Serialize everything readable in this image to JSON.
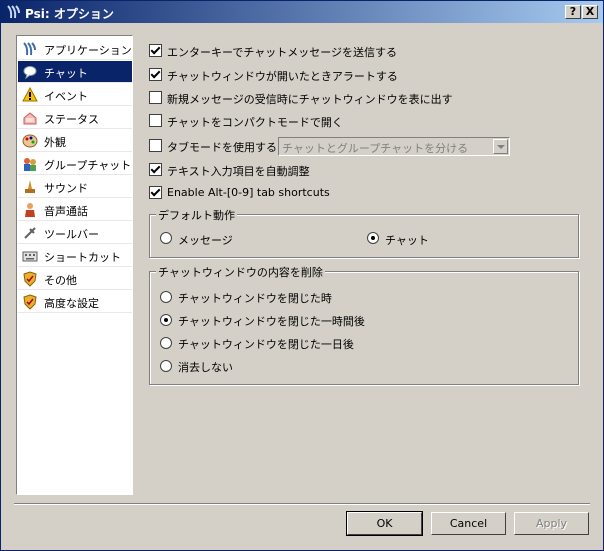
{
  "window": {
    "title": "Psi: オプション",
    "help_button": "?",
    "close_button": "X"
  },
  "sidebar": {
    "items": [
      {
        "label": "アプリケーション",
        "icon": "psi-logo-icon"
      },
      {
        "label": "チャット",
        "icon": "chat-bubble-icon"
      },
      {
        "label": "イベント",
        "icon": "warning-icon"
      },
      {
        "label": "ステータス",
        "icon": "status-icon"
      },
      {
        "label": "外観",
        "icon": "palette-icon"
      },
      {
        "label": "グループチャット",
        "icon": "groupchat-icon"
      },
      {
        "label": "サウンド",
        "icon": "sound-icon"
      },
      {
        "label": "音声通話",
        "icon": "voice-call-icon"
      },
      {
        "label": "ツールバー",
        "icon": "toolbar-icon"
      },
      {
        "label": "ショートカット",
        "icon": "keyboard-icon"
      },
      {
        "label": "その他",
        "icon": "shield-icon"
      },
      {
        "label": "高度な設定",
        "icon": "shield-icon"
      }
    ],
    "selected_index": 1
  },
  "options": {
    "send_on_enter": {
      "label": "エンターキーでチャットメッセージを送信する",
      "checked": true
    },
    "alert_on_open": {
      "label": "チャットウィンドウが開いたときアラートする",
      "checked": true
    },
    "raise_on_new": {
      "label": "新規メッセージの受信時にチャットウィンドウを表に出す",
      "checked": false
    },
    "compact_mode": {
      "label": "チャットをコンパクトモードで開く",
      "checked": false
    },
    "tab_mode": {
      "label": "タブモードを使用する:",
      "checked": false,
      "combo_value": "チャットとグループチャットを分ける"
    },
    "auto_resize": {
      "label": "テキスト入力項目を自動調整",
      "checked": true
    },
    "alt_shortcuts": {
      "label": "Enable Alt-[0-9] tab shortcuts",
      "checked": true
    }
  },
  "default_action": {
    "title": "デフォルト動作",
    "options": [
      "メッセージ",
      "チャット"
    ],
    "selected": 1
  },
  "delete_contents": {
    "title": "チャットウィンドウの内容を削除",
    "options": [
      "チャットウィンドウを閉じた時",
      "チャットウィンドウを閉じた一時間後",
      "チャットウィンドウを閉じた一日後",
      "消去しない"
    ],
    "selected": 1
  },
  "buttons": {
    "ok": "OK",
    "cancel": "Cancel",
    "apply": "Apply"
  },
  "colors": {
    "title_bar": "#0a246a",
    "selection": "#0a246a",
    "face": "#d4d0c8"
  }
}
